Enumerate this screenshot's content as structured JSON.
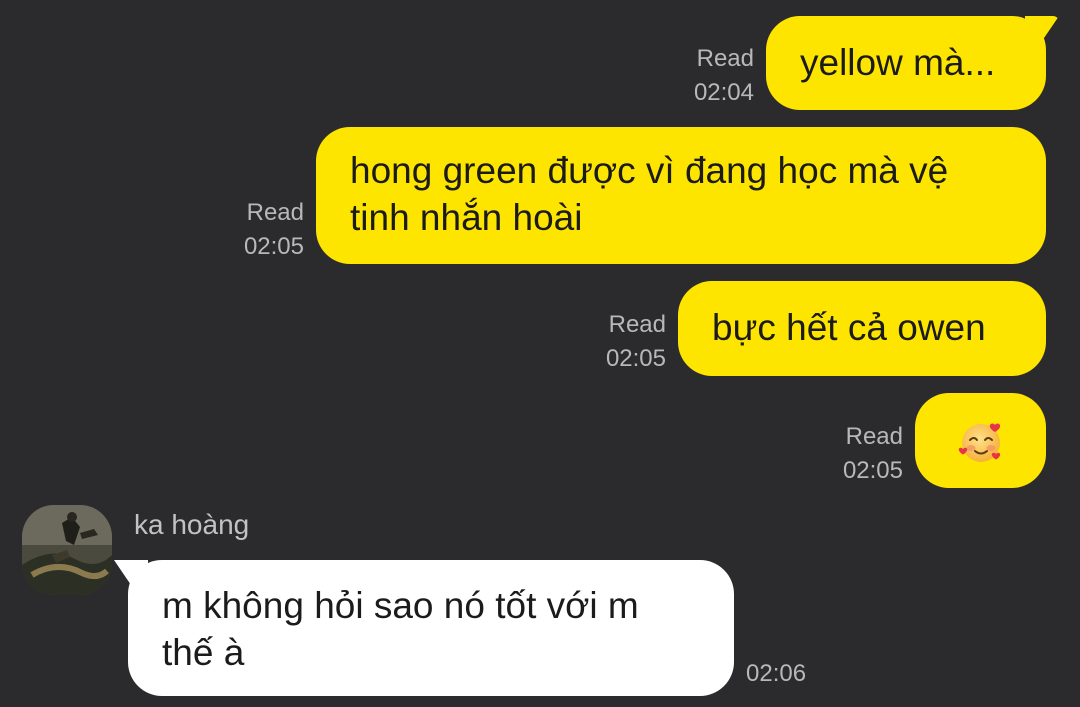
{
  "messages_out": [
    {
      "status": "Read",
      "time": "02:04",
      "text": "yellow mà..."
    },
    {
      "status": "Read",
      "time": "02:05",
      "text": "hong green được vì đang học mà vệ tinh nhắn hoài"
    },
    {
      "status": "Read",
      "time": "02:05",
      "text": "bực hết cả owen"
    },
    {
      "status": "Read",
      "time": "02:05",
      "emoji": "smiling-face-with-hearts"
    }
  ],
  "incoming": {
    "sender": "ka hoàng",
    "text": "m không hỏi sao nó tốt với m thế à",
    "time": "02:06"
  },
  "colors": {
    "background": "#2b2b2d",
    "outgoing_bubble": "#fee500",
    "incoming_bubble": "#ffffff",
    "meta_text": "#b8b8b8"
  }
}
